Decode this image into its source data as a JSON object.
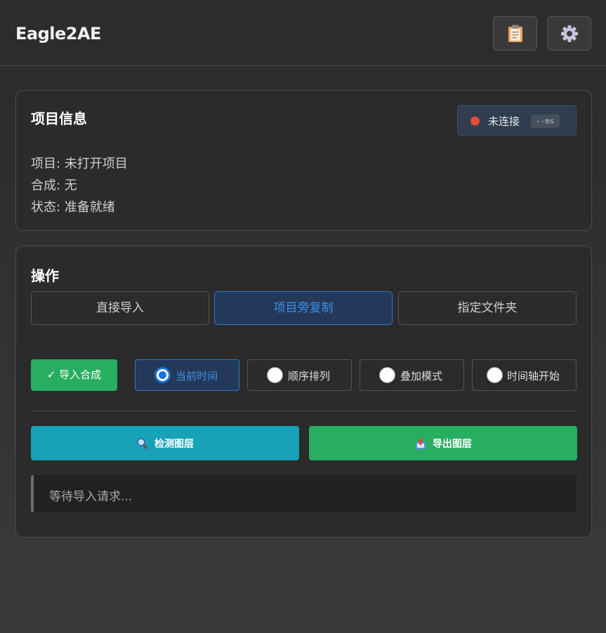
{
  "header": {
    "title": "Eagle2AE",
    "buttons": [
      {
        "icon": "clipboard-icon"
      },
      {
        "icon": "gear-icon"
      }
    ]
  },
  "project_info": {
    "title": "项目信息",
    "connection": {
      "status": "未连接",
      "latency": "--ms",
      "status_color": "#e74c3c"
    },
    "lines": [
      "项目: 未打开项目",
      "合成: 无",
      "状态: 准备就绪"
    ]
  },
  "operations": {
    "title": "操作",
    "tabs": [
      {
        "label": "直接导入",
        "active": false
      },
      {
        "label": "项目旁复制",
        "active": true
      },
      {
        "label": "指定文件夹",
        "active": false
      }
    ],
    "import_button": "✓ 导入合成",
    "import_modes": [
      {
        "label": "当前时间",
        "selected": true
      },
      {
        "label": "顺序排列",
        "selected": false
      },
      {
        "label": "叠加模式",
        "selected": false
      },
      {
        "label": "时间轴开始",
        "selected": false
      }
    ],
    "detect_button": {
      "label": "检测图层",
      "icon": "magnifier-icon",
      "color": "#17a2b8"
    },
    "export_button": {
      "label": "导出图层",
      "icon": "export-box-icon",
      "color": "#27ae60"
    },
    "status_message": "等待导入请求..."
  },
  "colors": {
    "accent": "#2d7bd1",
    "success": "#27ae60",
    "info": "#17a2b8"
  }
}
